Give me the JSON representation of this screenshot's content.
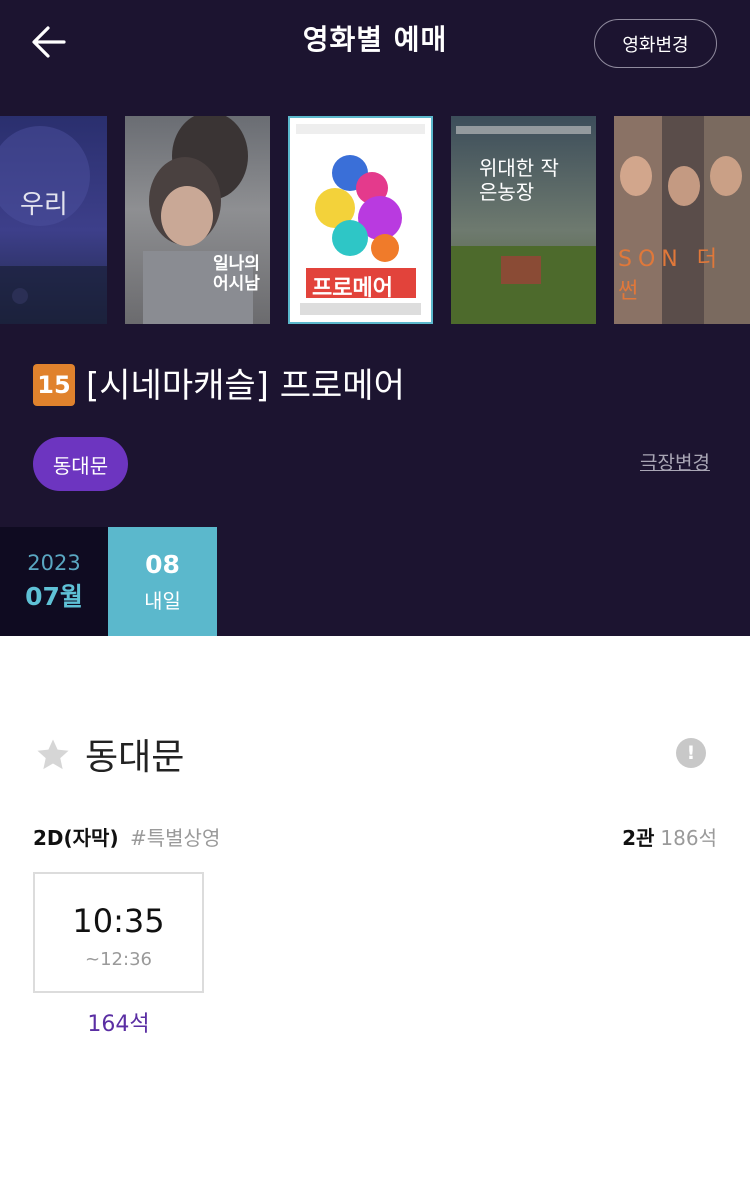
{
  "header": {
    "title": "영화별 예매",
    "change_movie_label": "영화변경"
  },
  "posters": [
    {
      "text": "우리",
      "selected": false
    },
    {
      "text": "일나의 어시남",
      "selected": false
    },
    {
      "text": "프로메어",
      "selected": true
    },
    {
      "text": "위대한 작은농장",
      "selected": false
    },
    {
      "text": "SON 더 썬",
      "selected": false
    }
  ],
  "movie": {
    "rating": "15",
    "title": "[시네마캐슬] 프로메어"
  },
  "theater_selector": {
    "selected": "동대문",
    "change_label": "극장변경"
  },
  "date": {
    "year": "2023",
    "month": "07월",
    "day": "08",
    "day_label": "내일"
  },
  "theater": {
    "name": "동대문"
  },
  "screening": {
    "format": "2D(자막)",
    "tag": "#특별상영",
    "hall": "2관",
    "total_seats": "186석",
    "showtimes": [
      {
        "start": "10:35",
        "end": "~12:36",
        "seats": "164석"
      }
    ]
  },
  "colors": {
    "background_dark": "#1c1430",
    "accent_purple": "#6d35c0",
    "accent_teal": "#5bb8cc",
    "rating_orange": "#e0822d"
  }
}
